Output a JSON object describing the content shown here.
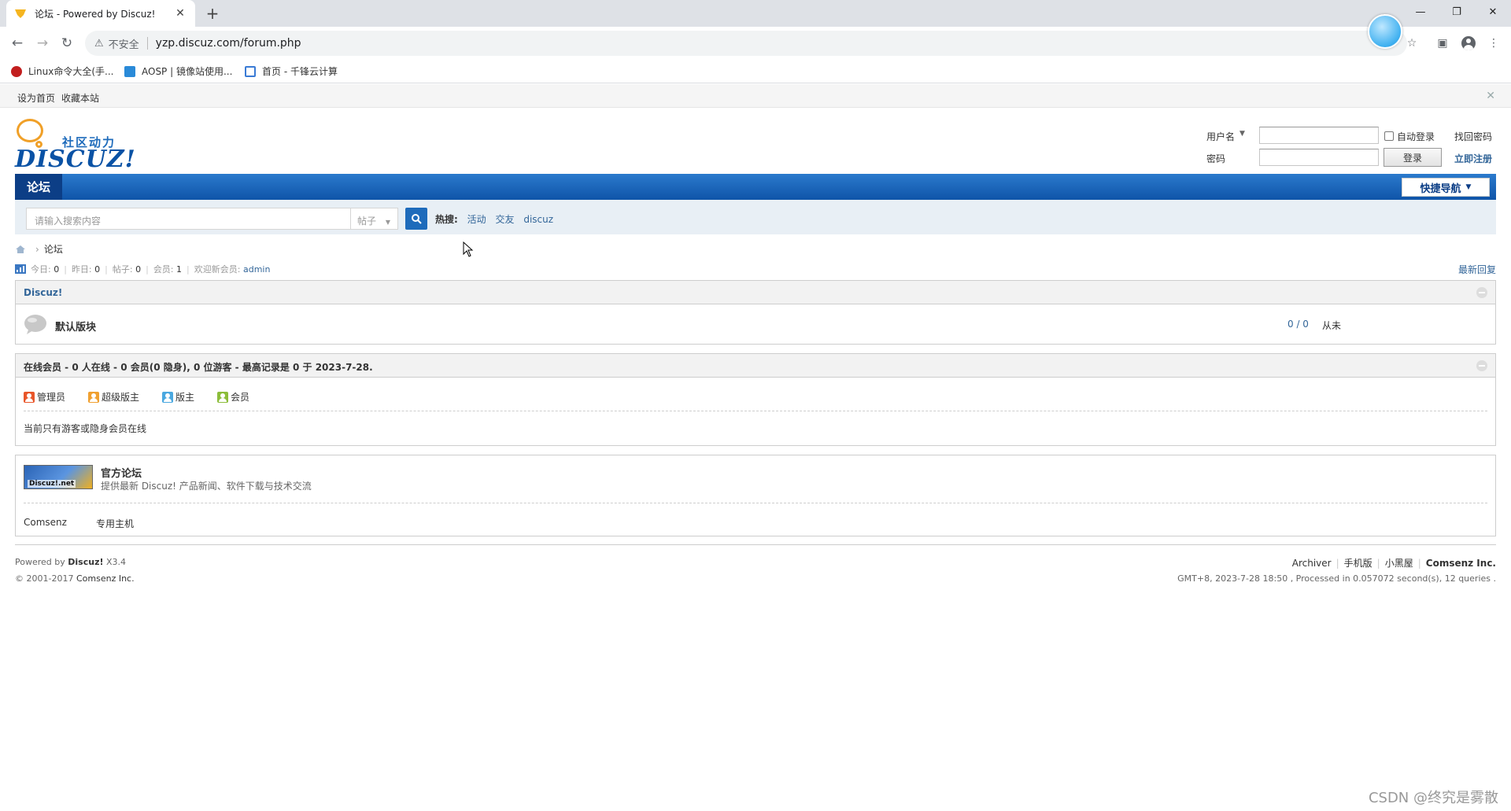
{
  "browser": {
    "tab_title": "论坛 - Powered by Discuz!",
    "insecure_label": "不安全",
    "url": "yzp.discuz.com/forum.php",
    "bookmarks": [
      "Linux命令大全(手...",
      "AOSP | 镜像站使用...",
      "首页 - 千锋云计算"
    ]
  },
  "topbar": {
    "set_home": "设为首页",
    "bookmark_site": "收藏本站"
  },
  "header": {
    "slogan": "社区动力",
    "logo_text": "DISCUZ!"
  },
  "login": {
    "username_label": "用户名",
    "password_label": "密码",
    "auto_login": "自动登录",
    "forgot_password": "找回密码",
    "login_button": "登录",
    "register": "立即注册"
  },
  "nav": {
    "forum": "论坛",
    "quick_nav": "快捷导航"
  },
  "search": {
    "placeholder": "请输入搜索内容",
    "type": "帖子",
    "hot_label": "热搜:",
    "hot_items": [
      "活动",
      "交友",
      "discuz"
    ]
  },
  "breadcrumb": {
    "current": "论坛"
  },
  "stats": {
    "today_label": "今日:",
    "today": "0",
    "yesterday_label": "昨日:",
    "yesterday": "0",
    "posts_label": "帖子:",
    "posts": "0",
    "members_label": "会员:",
    "members": "1",
    "welcome_label": "欢迎新会员:",
    "newest_member": "admin",
    "latest_replies": "最新回复"
  },
  "category": {
    "title": "Discuz!",
    "forums": [
      {
        "name": "默认版块",
        "counts": "0 / 0",
        "last_post": "从未"
      }
    ]
  },
  "online": {
    "title": "在线会员 - 0 人在线 - 0 会员(0 隐身), 0 位游客 - 最高记录是 0 于 2023-7-28.",
    "legend": [
      {
        "label": "管理员",
        "color": "#e8562a"
      },
      {
        "label": "超级版主",
        "color": "#f0a030"
      },
      {
        "label": "版主",
        "color": "#4aa8e0"
      },
      {
        "label": "会员",
        "color": "#8cbd3a"
      }
    ],
    "note": "当前只有游客或隐身会员在线"
  },
  "links": {
    "logo_text": "Discuz!.net",
    "name": "官方论坛",
    "desc": "提供最新 Discuz! 产品新闻、软件下载与技术交流",
    "text_links": [
      "Comsenz",
      "专用主机"
    ]
  },
  "footer": {
    "powered_prefix": "Powered by",
    "product": "Discuz!",
    "version": "X3.4",
    "copyright_prefix": "© 2001-2017",
    "company": "Comsenz Inc.",
    "links": [
      "Archiver",
      "手机版",
      "小黑屋",
      "Comsenz Inc."
    ],
    "processed": "GMT+8, 2023-7-28 18:50 , Processed in 0.057072 second(s), 12 queries ."
  },
  "watermark": "CSDN @终究是雾散"
}
